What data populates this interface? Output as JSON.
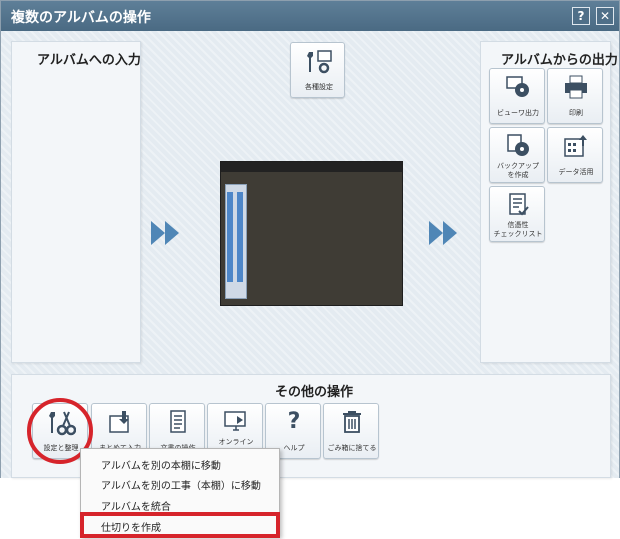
{
  "window": {
    "title": "複数のアルバムの操作",
    "help_label": "?",
    "close_label": "✕"
  },
  "input_panel": {
    "title": "アルバムへの入力"
  },
  "settings_tile": {
    "label": "各種設定",
    "icon": "wrench-gear-icon"
  },
  "output_panel": {
    "title": "アルバムからの出力",
    "buttons": [
      {
        "label": "ビューワ出力",
        "icon": "viewer-disc-icon"
      },
      {
        "label": "印刷",
        "icon": "printer-icon"
      },
      {
        "label": "バックアップ\nを作成",
        "icon": "backup-icon"
      },
      {
        "label": "データ活用",
        "icon": "data-export-icon"
      },
      {
        "label": "信憑性\nチェックリスト",
        "icon": "checklist-icon"
      }
    ]
  },
  "other_panel": {
    "title": "その他の操作",
    "buttons": [
      {
        "label": "設定と整理",
        "icon": "wrench-scissors-icon"
      },
      {
        "label": "まとめて入力",
        "icon": "batch-input-icon"
      },
      {
        "label": "文書の操作",
        "icon": "document-icon"
      },
      {
        "label": "オンライン\n...",
        "icon": "online-icon"
      },
      {
        "label": "ヘルプ",
        "icon": "help-icon"
      },
      {
        "label": "ごみ箱に捨てる",
        "icon": "trash-icon"
      }
    ]
  },
  "context_menu": {
    "items": [
      "アルバムを別の本棚に移動",
      "アルバムを別の工事（本棚）に移動",
      "アルバムを統合",
      "仕切りを作成"
    ]
  },
  "colors": {
    "accent": "#4f86b6",
    "highlight": "#d6242b",
    "titlebar": "#4f6f88"
  }
}
